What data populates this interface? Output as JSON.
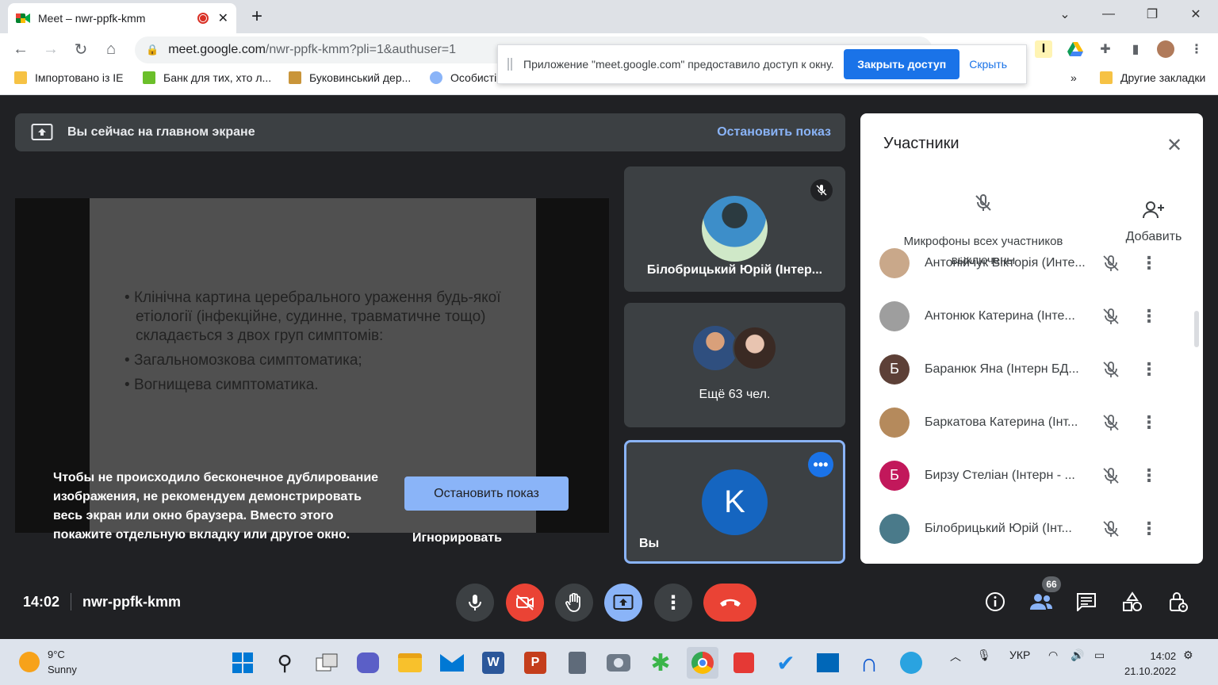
{
  "browser": {
    "tab_title": "Meet – nwr-ppfk-kmm",
    "url_host": "meet.google.com",
    "url_path": "/nwr-ppfk-kmm?pli=1&authuser=1",
    "bookmarks": [
      "Імпортовано із IE",
      "Банк для тих, хто л...",
      "Буковинський дер...",
      "Особисті"
    ],
    "other_bookmarks": "Другие закладки",
    "more_bookmarks": "»",
    "infobar": {
      "message": "Приложение \"meet.google.com\" предоставило доступ к окну.",
      "stop_label": "Закрыть доступ",
      "hide_label": "Скрыть"
    }
  },
  "meet": {
    "banner_text": "Вы сейчас на главном экране",
    "banner_stop": "Остановить показ",
    "slide_bullets": [
      "Клінічна картина церебрального ураження будь-якої етіології (інфекційне, судинне, травматичне тощо) складається з двох груп симптомів:",
      "Загальномозкова симптоматика;",
      "Вогнищева симптоматика."
    ],
    "warning": "Чтобы не происходило бесконечное дублирование изображения, не рекомендуем демонстрировать весь экран или окно браузера. Вместо этого покажите отдельную вкладку или другое окно.",
    "stop_button": "Остановить показ",
    "ignore_button": "Игнорировать",
    "tiles": {
      "speaker_name": "Білобрицький Юрій (Інтер...",
      "more_people": "Ещё 63 чел.",
      "self_initial": "K",
      "self_name": "Вы"
    },
    "time": "14:02",
    "meeting_code": "nwr-ppfk-kmm",
    "participant_count": "66",
    "colors": {
      "hangup": "#ea4335",
      "active": "#8ab4f8",
      "self_avatar": "#1565c0"
    }
  },
  "participants_panel": {
    "title": "Участники",
    "mute_all": "Микрофоны всех участников выключены",
    "add_label": "Добавить",
    "rows": [
      {
        "name": "Антонійчук Вікторія (Инте...",
        "initial": "",
        "color": "#c9a88a"
      },
      {
        "name": "Антонюк Катерина (Інте...",
        "initial": "",
        "color": "#9e9e9e"
      },
      {
        "name": "Баранюк Яна (Інтерн БД...",
        "initial": "Б",
        "color": "#5d4037"
      },
      {
        "name": "Баркатова Катерина (Інт...",
        "initial": "",
        "color": "#b58a5c"
      },
      {
        "name": "Бирзу Стеліан (Інтерн - ...",
        "initial": "Б",
        "color": "#c2185b"
      },
      {
        "name": "Білобрицький Юрій (Інт...",
        "initial": "",
        "color": "#4a7a8a"
      }
    ]
  },
  "taskbar": {
    "temp": "9°C",
    "weather": "Sunny",
    "lang": "УКР",
    "time": "14:02",
    "date": "21.10.2022"
  }
}
